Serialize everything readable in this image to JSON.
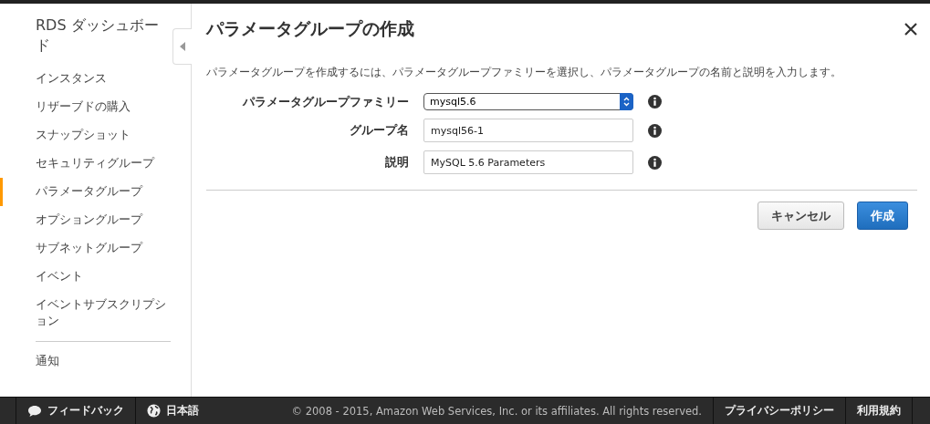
{
  "sidebar": {
    "title": "RDS ダッシュボード",
    "items": [
      {
        "label": "インスタンス",
        "selected": false
      },
      {
        "label": "リザーブドの購入",
        "selected": false
      },
      {
        "label": "スナップショット",
        "selected": false
      },
      {
        "label": "セキュリティグループ",
        "selected": false
      },
      {
        "label": "パラメータグループ",
        "selected": true
      },
      {
        "label": "オプショングループ",
        "selected": false
      },
      {
        "label": "サブネットグループ",
        "selected": false
      },
      {
        "label": "イベント",
        "selected": false
      },
      {
        "label": "イベントサブスクリプション",
        "selected": false
      }
    ],
    "footer_items": [
      {
        "label": "通知",
        "selected": false
      }
    ]
  },
  "dialog": {
    "title": "パラメータグループの作成",
    "description": "パラメータグループを作成するには、パラメータグループファミリーを選択し、パラメータグループの名前と説明を入力します。",
    "fields": [
      {
        "kind": "select",
        "label": "パラメータグループファミリー",
        "value": "mysql5.6"
      },
      {
        "kind": "text",
        "label": "グループ名",
        "value": "mysql56-1"
      },
      {
        "kind": "text",
        "label": "説明",
        "value": "MySQL 5.6 Parameters"
      }
    ],
    "buttons": [
      {
        "kind": "secondary",
        "label": "キャンセル"
      },
      {
        "kind": "primary",
        "label": "作成"
      }
    ]
  },
  "footer": {
    "feedback": "フィードバック",
    "language": "日本語",
    "copyright": "© 2008 - 2015, Amazon Web Services, Inc. or its affiliates. All rights reserved.",
    "links": [
      "プライバシーポリシー",
      "利用規約"
    ]
  }
}
